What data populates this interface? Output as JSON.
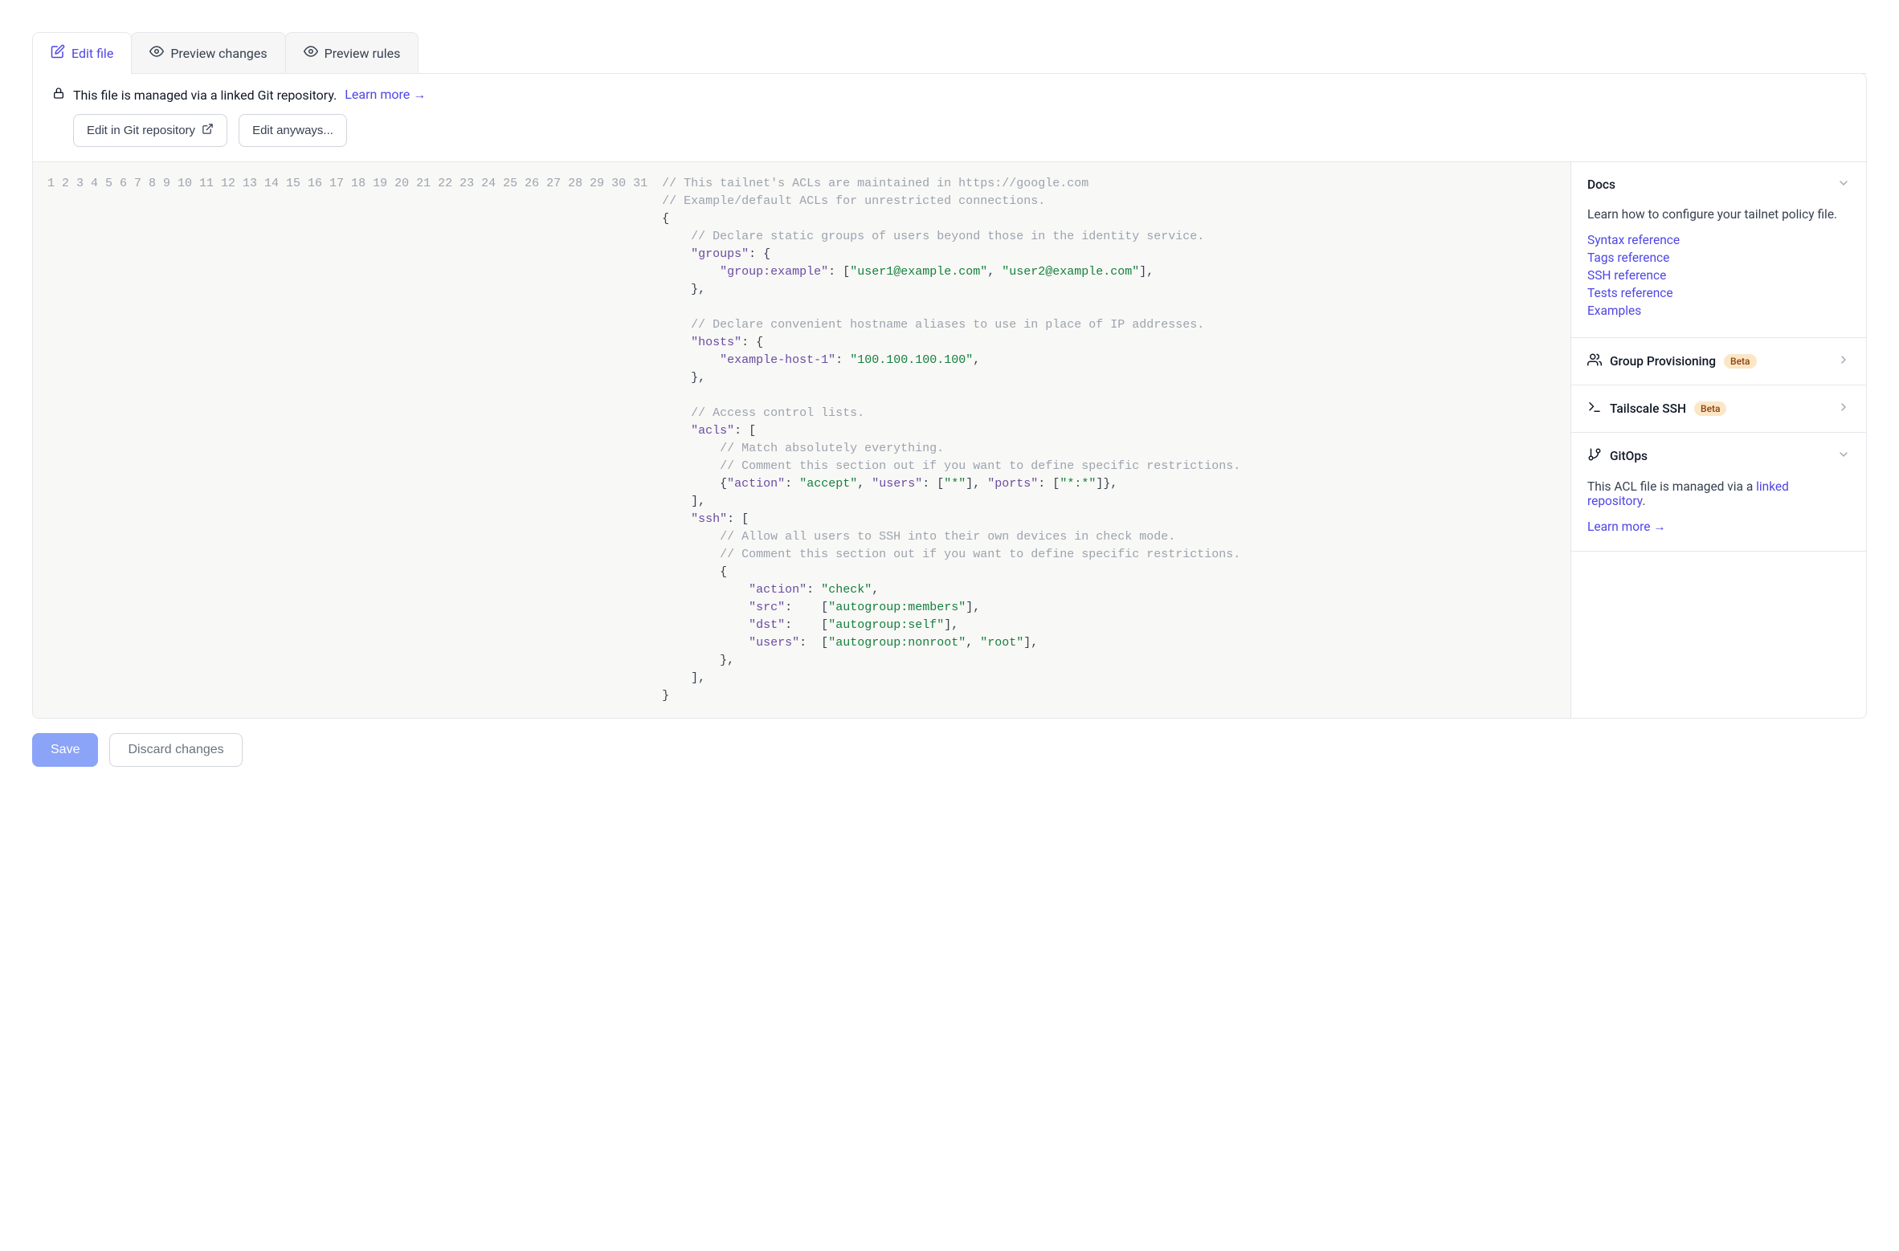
{
  "tabs": {
    "edit": "Edit file",
    "preview_changes": "Preview changes",
    "preview_rules": "Preview rules"
  },
  "notice": {
    "message": "This file is managed via a linked Git repository.",
    "learn_more": "Learn more →",
    "edit_in_repo": "Edit in Git repository",
    "edit_anyways": "Edit anyways..."
  },
  "code": {
    "line_count": 31,
    "lines": [
      [
        [
          "comment",
          "// This tailnet's ACLs are maintained in https://google.com"
        ]
      ],
      [
        [
          "comment",
          "// Example/default ACLs for unrestricted connections."
        ]
      ],
      [
        [
          "punct",
          "{"
        ]
      ],
      [
        [
          "indent",
          1
        ],
        [
          "comment",
          "// Declare static groups of users beyond those in the identity service."
        ]
      ],
      [
        [
          "indent",
          1
        ],
        [
          "key",
          "\"groups\""
        ],
        [
          "punct",
          ": {"
        ]
      ],
      [
        [
          "indent",
          2
        ],
        [
          "key",
          "\"group:example\""
        ],
        [
          "punct",
          ": ["
        ],
        [
          "string",
          "\"user1@example.com\""
        ],
        [
          "punct",
          ", "
        ],
        [
          "string",
          "\"user2@example.com\""
        ],
        [
          "punct",
          "],"
        ]
      ],
      [
        [
          "indent",
          1
        ],
        [
          "punct",
          "},"
        ]
      ],
      [],
      [
        [
          "indent",
          1
        ],
        [
          "comment",
          "// Declare convenient hostname aliases to use in place of IP addresses."
        ]
      ],
      [
        [
          "indent",
          1
        ],
        [
          "key",
          "\"hosts\""
        ],
        [
          "punct",
          ": {"
        ]
      ],
      [
        [
          "indent",
          2
        ],
        [
          "key",
          "\"example-host-1\""
        ],
        [
          "punct",
          ": "
        ],
        [
          "string",
          "\"100.100.100.100\""
        ],
        [
          "punct",
          ","
        ]
      ],
      [
        [
          "indent",
          1
        ],
        [
          "punct",
          "},"
        ]
      ],
      [],
      [
        [
          "indent",
          1
        ],
        [
          "comment",
          "// Access control lists."
        ]
      ],
      [
        [
          "indent",
          1
        ],
        [
          "key",
          "\"acls\""
        ],
        [
          "punct",
          ": ["
        ]
      ],
      [
        [
          "indent",
          2
        ],
        [
          "comment",
          "// Match absolutely everything."
        ]
      ],
      [
        [
          "indent",
          2
        ],
        [
          "comment",
          "// Comment this section out if you want to define specific restrictions."
        ]
      ],
      [
        [
          "indent",
          2
        ],
        [
          "punct",
          "{"
        ],
        [
          "key",
          "\"action\""
        ],
        [
          "punct",
          ": "
        ],
        [
          "string",
          "\"accept\""
        ],
        [
          "punct",
          ", "
        ],
        [
          "key",
          "\"users\""
        ],
        [
          "punct",
          ": ["
        ],
        [
          "string",
          "\"*\""
        ],
        [
          "punct",
          "], "
        ],
        [
          "key",
          "\"ports\""
        ],
        [
          "punct",
          ": ["
        ],
        [
          "string",
          "\"*:*\""
        ],
        [
          "punct",
          "]},"
        ]
      ],
      [
        [
          "indent",
          1
        ],
        [
          "punct",
          "],"
        ]
      ],
      [
        [
          "indent",
          1
        ],
        [
          "key",
          "\"ssh\""
        ],
        [
          "punct",
          ": ["
        ]
      ],
      [
        [
          "indent",
          2
        ],
        [
          "comment",
          "// Allow all users to SSH into their own devices in check mode."
        ]
      ],
      [
        [
          "indent",
          2
        ],
        [
          "comment",
          "// Comment this section out if you want to define specific restrictions."
        ]
      ],
      [
        [
          "indent",
          2
        ],
        [
          "punct",
          "{"
        ]
      ],
      [
        [
          "indent",
          3
        ],
        [
          "key",
          "\"action\""
        ],
        [
          "punct",
          ": "
        ],
        [
          "string",
          "\"check\""
        ],
        [
          "punct",
          ","
        ]
      ],
      [
        [
          "indent",
          3
        ],
        [
          "key",
          "\"src\""
        ],
        [
          "punct",
          ":    ["
        ],
        [
          "string",
          "\"autogroup:members\""
        ],
        [
          "punct",
          "],"
        ]
      ],
      [
        [
          "indent",
          3
        ],
        [
          "key",
          "\"dst\""
        ],
        [
          "punct",
          ":    ["
        ],
        [
          "string",
          "\"autogroup:self\""
        ],
        [
          "punct",
          "],"
        ]
      ],
      [
        [
          "indent",
          3
        ],
        [
          "key",
          "\"users\""
        ],
        [
          "punct",
          ":  ["
        ],
        [
          "string",
          "\"autogroup:nonroot\""
        ],
        [
          "punct",
          ", "
        ],
        [
          "string",
          "\"root\""
        ],
        [
          "punct",
          "],"
        ]
      ],
      [
        [
          "indent",
          2
        ],
        [
          "punct",
          "},"
        ]
      ],
      [
        [
          "indent",
          1
        ],
        [
          "punct",
          "],"
        ]
      ],
      [
        [
          "punct",
          "}"
        ]
      ],
      []
    ]
  },
  "sidebar": {
    "docs": {
      "title": "Docs",
      "intro": "Learn how to configure your tailnet policy file.",
      "links": [
        "Syntax reference",
        "Tags reference",
        "SSH reference",
        "Tests reference",
        "Examples"
      ]
    },
    "group_provisioning": {
      "title": "Group Provisioning",
      "badge": "Beta"
    },
    "tailscale_ssh": {
      "title": "Tailscale SSH",
      "badge": "Beta"
    },
    "gitops": {
      "title": "GitOps",
      "body_prefix": "This ACL file is managed via a ",
      "body_link": "linked repository",
      "body_suffix": ".",
      "learn_more": "Learn more →"
    }
  },
  "footer": {
    "save": "Save",
    "discard": "Discard changes"
  }
}
